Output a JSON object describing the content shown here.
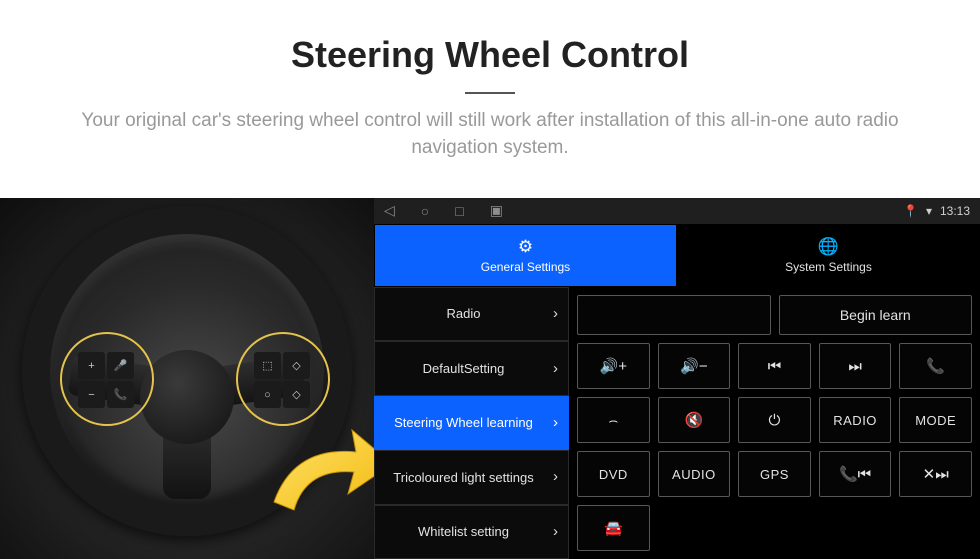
{
  "header": {
    "title": "Steering Wheel Control",
    "subtitle": "Your original car's steering wheel control will still work after installation of this all-in-one auto radio navigation system."
  },
  "statusbar": {
    "back_icon": "◁",
    "home_icon": "○",
    "recent_icon": "□",
    "app_icon": "▣",
    "location_icon": "📍",
    "wifi_icon": "▾",
    "time": "13:13"
  },
  "tabs": {
    "general": {
      "icon": "⚙",
      "label": "General Settings"
    },
    "system": {
      "icon": "🌐",
      "label": "System Settings"
    }
  },
  "menu": [
    {
      "label": "Radio",
      "active": false
    },
    {
      "label": "DefaultSetting",
      "active": false
    },
    {
      "label": "Steering Wheel learning",
      "active": true
    },
    {
      "label": "Tricoloured light settings",
      "active": false
    },
    {
      "label": "Whitelist setting",
      "active": false
    }
  ],
  "panel": {
    "begin": "Begin learn",
    "buttons": [
      "🔊+",
      "🔊−",
      "⏮",
      "⏭",
      "📞",
      "⌢",
      "🔇",
      "⏻",
      "RADIO",
      "MODE",
      "DVD",
      "AUDIO",
      "GPS",
      "📞⏮",
      "✕⏭",
      "🚘"
    ],
    "button_text_flags": [
      false,
      false,
      false,
      false,
      false,
      false,
      false,
      false,
      true,
      true,
      true,
      true,
      true,
      false,
      false,
      false
    ]
  },
  "wheel_pads": {
    "left": [
      "+",
      "🎤",
      "−",
      "📞"
    ],
    "right": [
      "⬚",
      "◇",
      "○",
      "◇"
    ]
  }
}
